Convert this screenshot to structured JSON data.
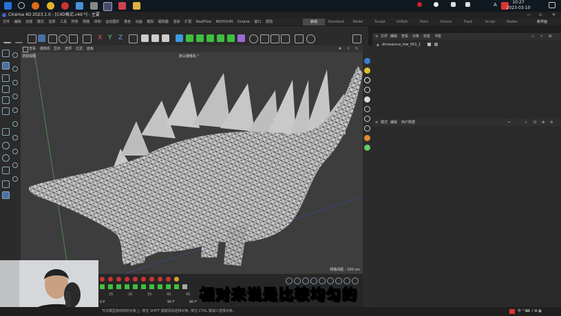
{
  "taskbar": {
    "time": "10:27",
    "date": "2023-03-10",
    "lang": "A"
  },
  "window": {
    "title": "Cinema 4D 2023.1.0 - [C4D格式.c4d *] - 主要"
  },
  "menubar": {
    "items": [
      "文件",
      "编辑",
      "创建",
      "模式",
      "选择",
      "工具",
      "样条",
      "网格",
      "体积",
      "运动图形",
      "角色",
      "动画",
      "模拟",
      "跟踪器",
      "渲染",
      "扩展",
      "RealFlow",
      "INSYDIUM",
      "Octane",
      "窗口",
      "帮助"
    ],
    "layout_tabs": [
      "启动",
      "Standard",
      "Model",
      "Sculpt",
      "UVEdit",
      "Paint",
      "Groom",
      "Track",
      "Script",
      "Nodes"
    ],
    "active_layout": "启动",
    "new_layout": "新界面"
  },
  "viewport": {
    "menu": [
      "查看",
      "摄像机",
      "显示",
      "选项",
      "过滤",
      "面板"
    ],
    "label": "透视视图",
    "camera": "默认摄像机 °",
    "grid": "网格间距 : 100 cm"
  },
  "object_manager": {
    "menu": [
      "文件",
      "编辑",
      "查看",
      "对象",
      "标签",
      "书签"
    ],
    "object_name": "dinosaurus_low_001_1"
  },
  "attribute_manager": {
    "menu": [
      "模式",
      "编辑",
      "用户数据"
    ]
  },
  "timeline": {
    "frames": [
      "25",
      "30",
      "35",
      "40",
      "45"
    ],
    "start": "0 F",
    "end": "90 F",
    "current": "90 F"
  },
  "subtitle": "相对来说是比较均匀的",
  "status": "节点模型拖动到的对象上: 按住 SHIFT 键键添加选择对象; 按住 CTRL 键减少选择对象。",
  "colors": {
    "accent": "#3b7fd4",
    "active_tool": "#4b6fa5",
    "green_tools": "#3fbf3f"
  }
}
